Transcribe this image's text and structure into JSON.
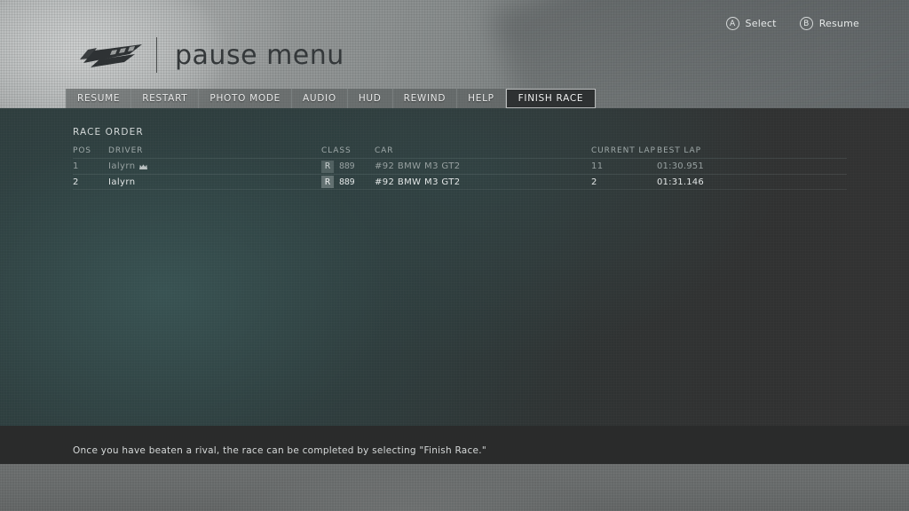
{
  "header": {
    "logo_icon": "forza-logo-icon",
    "title": "pause menu"
  },
  "tabs": [
    {
      "label": "RESUME",
      "active": false
    },
    {
      "label": "RESTART",
      "active": false
    },
    {
      "label": "PHOTO MODE",
      "active": false
    },
    {
      "label": "AUDIO",
      "active": false
    },
    {
      "label": "HUD",
      "active": false
    },
    {
      "label": "REWIND",
      "active": false
    },
    {
      "label": "HELP",
      "active": false
    },
    {
      "label": "FINISH RACE",
      "active": true
    }
  ],
  "race_order": {
    "panel_title": "RACE ORDER",
    "columns": {
      "pos": "POS",
      "driver": "DRIVER",
      "class": "CLASS",
      "car": "CAR",
      "current_lap": "CURRENT LAP",
      "best_lap": "BEST LAP"
    },
    "rows": [
      {
        "pos": "1",
        "driver": "Ialyrn",
        "badge_icon": "crown-icon",
        "class_letter": "R",
        "class_pi": "889",
        "car": "#92 BMW M3 GT2",
        "current_lap": "11",
        "best_lap": "01:30.951"
      },
      {
        "pos": "2",
        "driver": "Ialyrn",
        "badge_icon": "",
        "class_letter": "R",
        "class_pi": "889",
        "car": "#92 BMW M3 GT2",
        "current_lap": "2",
        "best_lap": "01:31.146"
      }
    ]
  },
  "hint": {
    "text": "Once you have beaten a rival, the race can be completed by selecting \"Finish Race.\""
  },
  "footer": {
    "prompts": [
      {
        "glyph": "A",
        "label": "Select",
        "icon": "button-a-icon"
      },
      {
        "glyph": "B",
        "label": "Resume",
        "icon": "button-b-icon"
      }
    ]
  },
  "colors": {
    "header_band": "#9a9d9d",
    "content_teal": "#2e3b3b",
    "content_dark": "#323232",
    "tab_active_bg": "#2e3132",
    "tab_active_border": "#b9bcbc",
    "hint_strip": "#2a2b2b",
    "footer_bar": "#686b6b",
    "text_primary": "#e2e6e6",
    "text_dim": "#97a0a0"
  }
}
